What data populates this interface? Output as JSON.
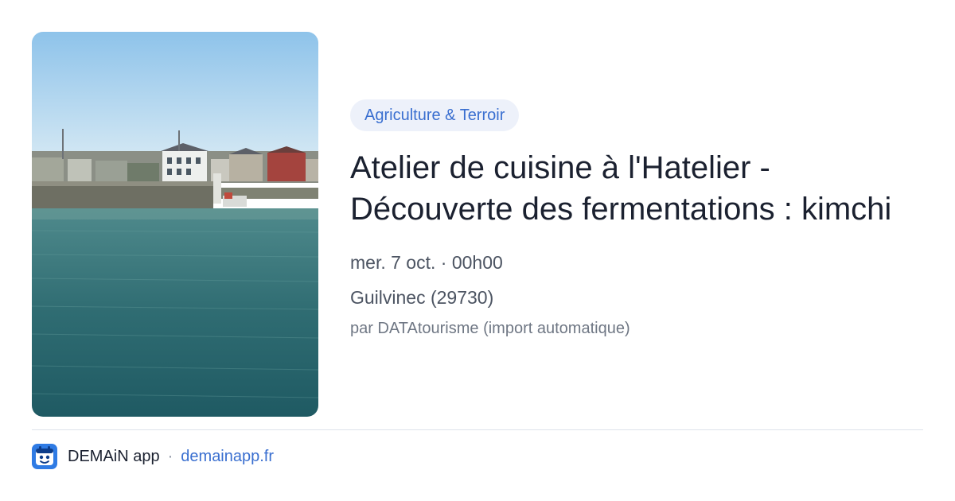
{
  "event": {
    "category": "Agriculture & Terroir",
    "title": "Atelier de cuisine à l'Hatelier - Découverte des fermentations : kimchi",
    "date": "mer. 7 oct. · 00h00",
    "location": "Guilvinec (29730)",
    "source": "par DATAtourisme (import automatique)"
  },
  "footer": {
    "app_name": "DEMAiN app",
    "separator": "·",
    "domain": "demainapp.fr"
  },
  "colors": {
    "accent": "#3a6fd0",
    "chip_bg": "#edf1fa",
    "title": "#1b2130",
    "meta": "#4c5462",
    "muted": "#6f7784"
  },
  "icons": {
    "app_logo": "demain-app-logo-icon"
  }
}
